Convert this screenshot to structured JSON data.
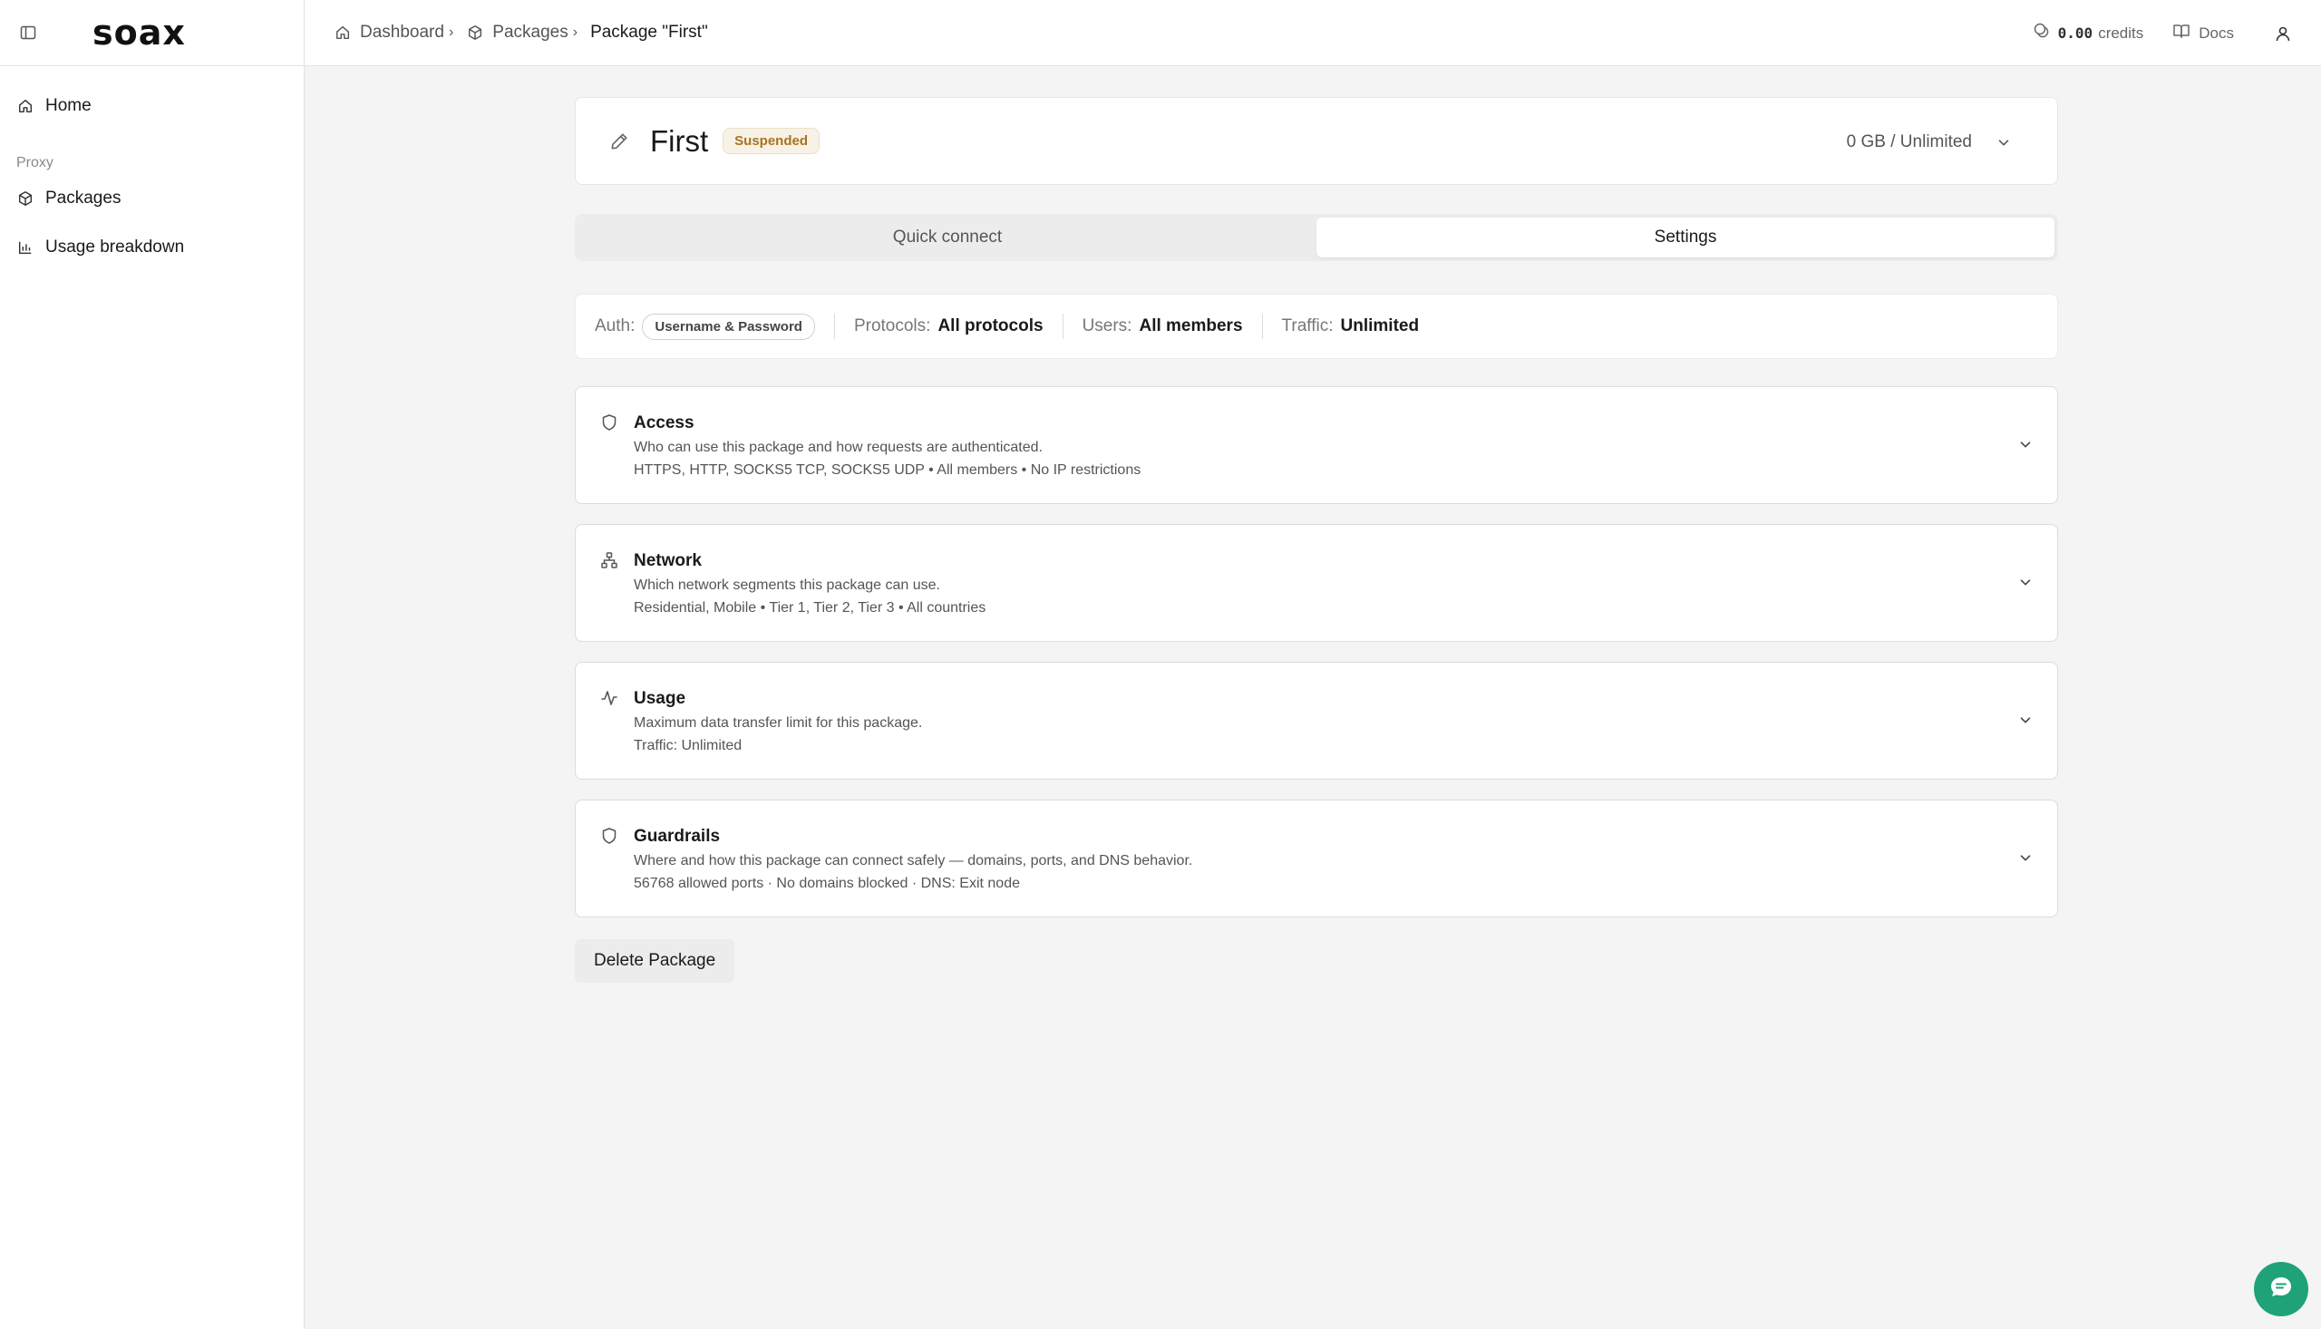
{
  "sidebar": {
    "logo": "soax",
    "items": [
      {
        "label": "Home"
      },
      {
        "label": "Packages"
      },
      {
        "label": "Usage breakdown"
      }
    ],
    "section_label": "Proxy"
  },
  "header": {
    "breadcrumb": [
      {
        "label": "Dashboard"
      },
      {
        "label": "Packages"
      },
      {
        "label": "Package \"First\""
      }
    ],
    "credits_value": "0.00",
    "credits_label": "credits",
    "docs_label": "Docs"
  },
  "package": {
    "name": "First",
    "status": "Suspended",
    "usage": "0 GB / Unlimited"
  },
  "tabs": [
    {
      "label": "Quick connect",
      "active": false
    },
    {
      "label": "Settings",
      "active": true
    }
  ],
  "summary": {
    "auth_label": "Auth:",
    "auth_value": "Username & Password",
    "protocols_label": "Protocols:",
    "protocols_value": "All protocols",
    "users_label": "Users:",
    "users_value": "All members",
    "traffic_label": "Traffic:",
    "traffic_value": "Unlimited"
  },
  "sections": [
    {
      "icon": "shield-icon",
      "title": "Access",
      "description": "Who can use this package and how requests are authenticated.",
      "meta": "HTTPS, HTTP, SOCKS5 TCP, SOCKS5 UDP • All members • No IP restrictions"
    },
    {
      "icon": "network-icon",
      "title": "Network",
      "description": "Which network segments this package can use.",
      "meta": "Residential, Mobile • Tier 1, Tier 2, Tier 3 • All countries"
    },
    {
      "icon": "activity-icon",
      "title": "Usage",
      "description": "Maximum data transfer limit for this package.",
      "meta": "Traffic: Unlimited"
    },
    {
      "icon": "shield-icon",
      "title": "Guardrails",
      "description": "Where and how this package can connect safely — domains, ports, and DNS behavior.",
      "meta": "56768 allowed ports · No domains blocked · DNS: Exit node"
    }
  ],
  "actions": {
    "delete_label": "Delete Package"
  },
  "colors": {
    "accent_chat": "#1fa27a",
    "badge_text": "#a8741c",
    "badge_bg": "#f7f1e6"
  }
}
